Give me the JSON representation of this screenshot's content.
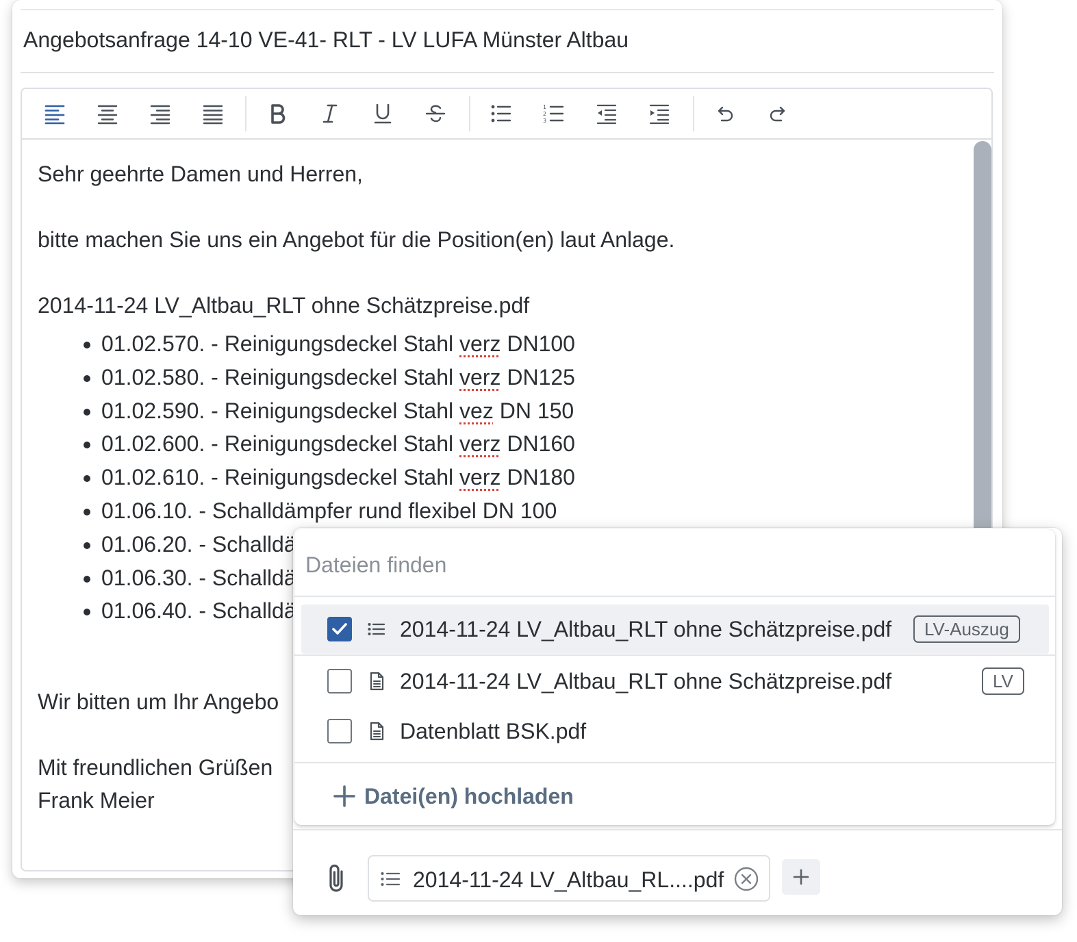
{
  "subject": "Angebotsanfrage 14-10 VE-41- RLT - LV LUFA Münster Altbau",
  "toolbar": {
    "buttons": [
      {
        "name": "align-left-button",
        "icon": "align-left-icon",
        "active": true
      },
      {
        "name": "align-center-button",
        "icon": "align-center-icon"
      },
      {
        "name": "align-right-button",
        "icon": "align-right-icon"
      },
      {
        "name": "align-justify-button",
        "icon": "align-justify-icon"
      },
      {
        "name": "bold-button",
        "icon": "bold-icon"
      },
      {
        "name": "italic-button",
        "icon": "italic-icon"
      },
      {
        "name": "underline-button",
        "icon": "underline-icon"
      },
      {
        "name": "strikethrough-button",
        "icon": "strikethrough-icon"
      },
      {
        "name": "bullet-list-button",
        "icon": "bullet-list-icon"
      },
      {
        "name": "numbered-list-button",
        "icon": "numbered-list-icon"
      },
      {
        "name": "outdent-button",
        "icon": "outdent-icon"
      },
      {
        "name": "indent-button",
        "icon": "indent-icon"
      },
      {
        "name": "undo-button",
        "icon": "undo-icon"
      },
      {
        "name": "redo-button",
        "icon": "redo-icon"
      }
    ],
    "active_color": "#2f5fa5",
    "icon_color": "#4a5057"
  },
  "body": {
    "greeting": "Sehr geehrte Damen und Herren,",
    "request": "bitte machen Sie uns ein Angebot für die Position(en) laut Anlage.",
    "file_heading": "2014-11-24 LV_Altbau_RLT ohne Schätzpreise.pdf",
    "positions": [
      {
        "pre": "01.02.570. - Reinigungsdeckel Stahl ",
        "flag": "verz",
        "post": " DN100"
      },
      {
        "pre": "01.02.580. - Reinigungsdeckel Stahl ",
        "flag": "verz",
        "post": " DN125"
      },
      {
        "pre": "01.02.590. - Reinigungsdeckel Stahl ",
        "flag": "vez",
        "post": " DN 150"
      },
      {
        "pre": "01.02.600. - Reinigungsdeckel Stahl ",
        "flag": "verz",
        "post": " DN160"
      },
      {
        "pre": "01.02.610. - Reinigungsdeckel Stahl ",
        "flag": "verz",
        "post": " DN180"
      },
      {
        "pre": "01.06.10. - Schalldämpfer rund flexibel DN 100",
        "flag": "",
        "post": ""
      },
      {
        "pre": "01.06.20. - Schalldä",
        "flag": "",
        "post": ""
      },
      {
        "pre": "01.06.30. - Schalldä",
        "flag": "",
        "post": ""
      },
      {
        "pre": "01.06.40. - Schalldä",
        "flag": "",
        "post": ""
      }
    ],
    "closing_request": "Wir bitten um Ihr Angebo",
    "regards": "Mit freundlichen Grüßen",
    "signature": "Frank Meier"
  },
  "file_picker": {
    "search_placeholder": "Dateien finden",
    "files": [
      {
        "name": "2014-11-24 LV_Altbau_RLT ohne Schätzpreise.pdf",
        "tag": "LV-Auszug",
        "checked": true,
        "icon": "list-icon"
      },
      {
        "name": "2014-11-24 LV_Altbau_RLT ohne Schätzpreise.pdf",
        "tag": "LV",
        "checked": false,
        "icon": "document-icon"
      },
      {
        "name": "Datenblatt BSK.pdf",
        "tag": "",
        "checked": false,
        "icon": "document-icon"
      }
    ],
    "upload_label": "Datei(en) hochladen"
  },
  "attachments": {
    "chips": [
      {
        "name": "2014-11-24 LV_Altbau_RL....pdf",
        "icon": "list-icon"
      }
    ],
    "add_label": "+"
  },
  "colors": {
    "accent": "#2f5fa5",
    "scrollbar": "#aab1ba",
    "selected_row": "#eef0f3",
    "upload_text": "#5a6d82",
    "spell_error": "#d9403b"
  }
}
